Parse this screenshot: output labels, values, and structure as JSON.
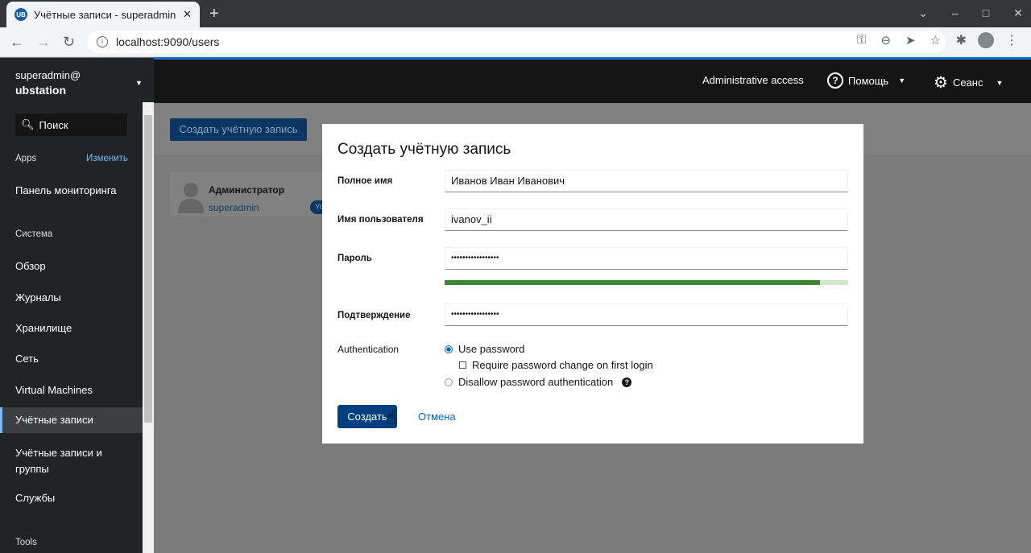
{
  "browser": {
    "tab_title": "Учётные записи - superadmin",
    "logo_text": "UB",
    "url": "localhost:9090/users"
  },
  "sidebar": {
    "user": "superadmin@",
    "host": "ubstation",
    "search_placeholder": "Поиск",
    "apps_label": "Apps",
    "edit_label": "Изменить",
    "dashboard": "Панель мониторинга",
    "system_label": "Система",
    "items": [
      {
        "label": "Обзор"
      },
      {
        "label": "Журналы"
      },
      {
        "label": "Хранилище"
      },
      {
        "label": "Сеть"
      },
      {
        "label": "Virtual Machines"
      },
      {
        "label": "Учётные записи",
        "active": true
      },
      {
        "label": "Учётные записи и группы"
      },
      {
        "label": "Службы"
      }
    ],
    "tools_label": "Tools"
  },
  "header": {
    "admin_access": "Administrative access",
    "help": "Помощь",
    "session": "Сеанс"
  },
  "page": {
    "create_button": "Создать учётную запись",
    "user_card": {
      "name": "Администратор",
      "login": "superadmin",
      "badge": "Yo"
    }
  },
  "dialog": {
    "title": "Создать учётную запись",
    "full_name_label": "Полное имя",
    "full_name": "Иванов Иван Иванович",
    "username_label": "Имя пользователя",
    "username": "ivanov_ii",
    "password_label": "Пароль",
    "password": "•••••••••••••••••",
    "password_strength_percent": 93,
    "confirm_label": "Подтверждение",
    "confirm": "•••••••••••••••••",
    "auth_label": "Authentication",
    "use_password": "Use password",
    "require_change": "Require password change on first login",
    "disallow": "Disallow password authentication",
    "create": "Создать",
    "cancel": "Отмена"
  },
  "colors": {
    "accent": "#0066cc",
    "strength": "#3e8635",
    "primary_button": "#004080"
  }
}
